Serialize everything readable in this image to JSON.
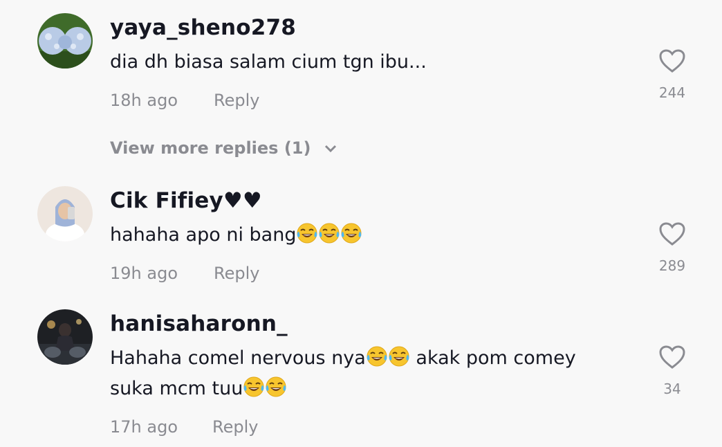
{
  "comments": [
    {
      "username": "yaya_sheno278",
      "text": "dia dh biasa salam cium tgn ibu...",
      "time": "18h ago",
      "reply_label": "Reply",
      "likes": "244"
    },
    {
      "username": "Cik Fifiey♥♥",
      "text": "hahaha apo ni bang",
      "time": "19h ago",
      "reply_label": "Reply",
      "likes": "289"
    },
    {
      "username": "hanisaharonn_",
      "text_line1": "Hahaha comel nervous nya",
      "text_line1_tail": " akak pom comey",
      "text_line2": "suka mcm tuu",
      "time": "17h ago",
      "reply_label": "Reply",
      "likes": "34"
    }
  ],
  "view_more": "View more replies (1)",
  "icons": {
    "like": "heart-outline-icon",
    "expand": "chevron-down-icon",
    "emoji": "face-with-tears-of-joy-emoji"
  },
  "colors": {
    "background": "#f8f8f8",
    "primary_text": "#161823",
    "secondary_text": "#8a8b91"
  }
}
